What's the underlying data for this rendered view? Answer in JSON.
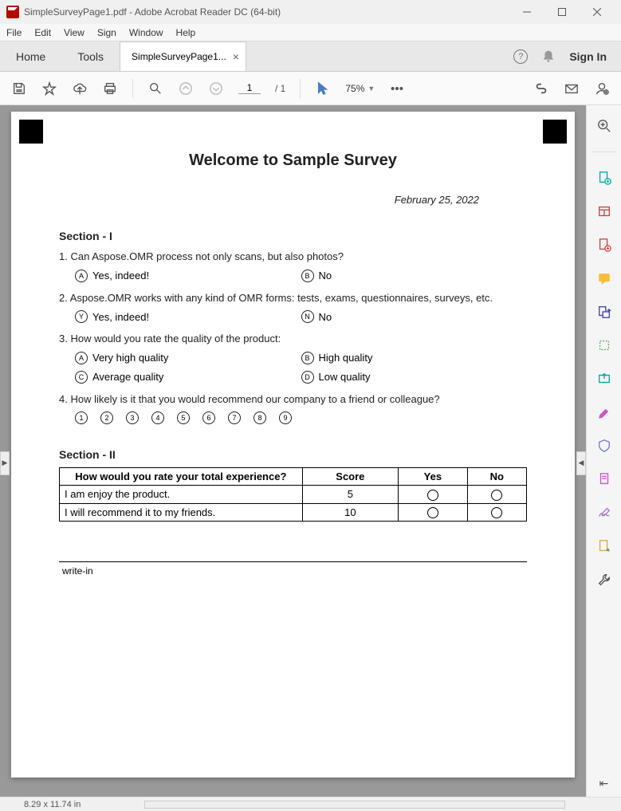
{
  "window": {
    "title": "SimpleSurveyPage1.pdf - Adobe Acrobat Reader DC (64-bit)"
  },
  "menu": {
    "file": "File",
    "edit": "Edit",
    "view": "View",
    "sign": "Sign",
    "window": "Window",
    "help": "Help"
  },
  "tabs": {
    "home": "Home",
    "tools": "Tools",
    "doc_name": "SimpleSurveyPage1...",
    "sign_in": "Sign In"
  },
  "toolbar": {
    "page_current": "1",
    "page_total": "/ 1",
    "zoom": "75%"
  },
  "document": {
    "title": "Welcome to Sample Survey",
    "date": "February 25, 2022",
    "section1": {
      "title": "Section - I",
      "q1": {
        "text": "1. Can Aspose.OMR process not only scans, but also photos?",
        "opt_a_letter": "A",
        "opt_a": "Yes, indeed!",
        "opt_b_letter": "B",
        "opt_b": "No"
      },
      "q2": {
        "text": "2. Aspose.OMR works with any kind of OMR forms: tests, exams, questionnaires, surveys, etc.",
        "opt_y_letter": "Y",
        "opt_y": "Yes, indeed!",
        "opt_n_letter": "N",
        "opt_n": "No"
      },
      "q3": {
        "text": "3. How would you rate the quality of the product:",
        "opt_a_letter": "A",
        "opt_a": "Very high quality",
        "opt_b_letter": "B",
        "opt_b": "High quality",
        "opt_c_letter": "C",
        "opt_c": "Average quality",
        "opt_d_letter": "D",
        "opt_d": "Low quality"
      },
      "q4": {
        "text": "4. How likely is it that you would recommend our company to a friend or colleague?",
        "nums": [
          "1",
          "2",
          "3",
          "4",
          "5",
          "6",
          "7",
          "8",
          "9"
        ]
      }
    },
    "section2": {
      "title": "Section - II",
      "headers": {
        "h1": "How would you rate your total experience?",
        "h2": "Score",
        "h3": "Yes",
        "h4": "No"
      },
      "rows": [
        {
          "text": "I am enjoy the product.",
          "score": "5"
        },
        {
          "text": "I will recommend it to my friends.",
          "score": "10"
        }
      ],
      "writein": "write-in"
    }
  },
  "statusbar": {
    "dims": "8.29 x 11.74 in"
  }
}
